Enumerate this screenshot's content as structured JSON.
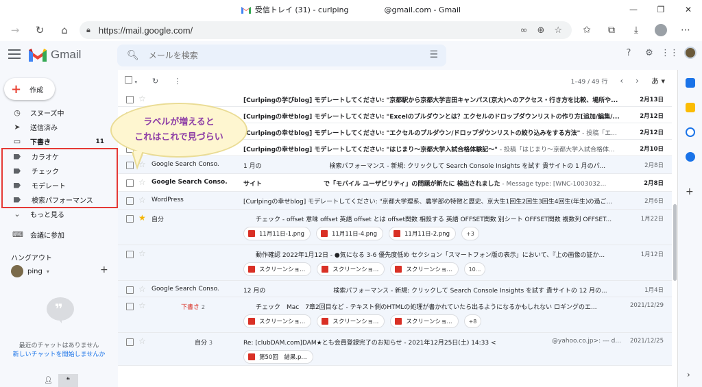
{
  "window": {
    "title_prefix": "受信トレイ (31) - curlping",
    "title_suffix": "@gmail.com - Gmail"
  },
  "browser": {
    "url": "https://mail.google.com/",
    "window_controls": [
      "—",
      "❐",
      "✕"
    ]
  },
  "gmail": {
    "logo_text": "Gmail",
    "search_placeholder": "メールを検索"
  },
  "nav": {
    "compose": "作成",
    "items": [
      {
        "icon": "snooze-icon",
        "label": "スヌーズ中",
        "count": ""
      },
      {
        "icon": "send-icon",
        "label": "送信済み",
        "count": ""
      },
      {
        "icon": "draft-icon",
        "label": "下書き",
        "count": "11"
      }
    ],
    "labels": [
      "カラオケ",
      "チェック",
      "モデレート",
      "検索パフォーマンス"
    ],
    "more": "もっと見る",
    "meet": "会議に参加"
  },
  "hangouts": {
    "title": "ハングアウト",
    "user": "ping",
    "no_chats": "最近のチャットはありません",
    "start_chat": "新しいチャットを開始しませんか"
  },
  "toolbar": {
    "range": "1–49 / 49 行",
    "lang": "あ"
  },
  "callout": {
    "line1": "ラベルが増えると",
    "line2": "これはこれで見づらい"
  },
  "emails": [
    {
      "sender": "",
      "subject": "[Curlpingの学びblog] モデレートしてください: \"京都駅から京都大学吉田キャンパス(京大)へのアクセス・行き方を比較、場所や...",
      "snippet": "",
      "date": "2月13日",
      "unread": true,
      "starred": false
    },
    {
      "sender": "",
      "subject": "[Curlpingの幸せblog] モデレートしてください: \"Excelのプルダウンとは？エクセルのドロップダウンリストの作り方[追加/編集/...",
      "snippet": "",
      "date": "2月12日",
      "unread": true,
      "starred": false
    },
    {
      "sender": "",
      "subject": "[Curlpingの幸せblog] モデレートしてください: \"エクセルのプルダウン/ドロップダウンリストの絞り込みをする方法\"",
      "snippet": " - 投稿「エ...",
      "date": "2月12日",
      "unread": true,
      "starred": false
    },
    {
      "sender": "",
      "subject": "[Curlpingの幸せblog] モデレートしてください: \"はじまり〜京都大学入試合格体験記〜\"",
      "snippet": " - 投稿「はじまり〜京都大学入試合格体...",
      "date": "2月10日",
      "unread": true,
      "starred": false
    },
    {
      "sender": "Google Search Conso.",
      "subject": "1 月の　　　　　　　　　　　検索パフォーマンス - 新規: クリックして Search Console Insights を試す 貴サイトの 1 月のパ...",
      "snippet": "",
      "date": "2月8日",
      "unread": false,
      "starred": false
    },
    {
      "sender": "Google Search Conso.",
      "subject": "サイト　　　　　　　　　　で「モバイル ユーザビリティ」の問題が新たに 検出されました",
      "snippet": " - Message type: [WNC-1003032...",
      "date": "2月8日",
      "unread": true,
      "starred": false
    },
    {
      "sender": "WordPress",
      "subject": "[Curlpingの幸せblog] モデレートしてください: \"京都大学理系、農学部の特徴と歴史、京大生1回生2回生3回生4回生(年生)の過ご...",
      "snippet": "",
      "date": "2月6日",
      "unread": false,
      "starred": false
    },
    {
      "sender": "自分",
      "subject": "チェック - offset 意味 offset 英語 offset とは offset関数 相殺する 英語 OFFSET関数 別シート OFFSET関数 複数列 OFFSET...",
      "snippet": "",
      "date": "1月22日",
      "unread": false,
      "starred": true,
      "attachments": [
        "11月11日-1.png",
        "11月11日-4.png",
        "11月11日-2.png"
      ],
      "more": "+3"
    },
    {
      "sender": "",
      "subject": "動作確認 2022年1月12日 - ●気になる 3-6 優先度低め セクション「スマートフォン版の表示」において、『上の画像の証か...",
      "snippet": "",
      "date": "1月12日",
      "unread": false,
      "starred": false,
      "attachments": [
        "スクリーンショ...",
        "スクリーンショ...",
        "スクリーンショ..."
      ],
      "more": "10..."
    },
    {
      "sender": "Google Search Conso.",
      "subject": "12 月の　　　　　　　　　　　検索パフォーマンス - 新規: クリックして Search Console Insights を試す 貴サイトの 12 月の...",
      "snippet": "",
      "date": "1月4日",
      "unread": false,
      "starred": false
    },
    {
      "sender": "下書き",
      "sender_count": "2",
      "subject": "チェック　Mac　7章2回目など - テキスト側のHTMLの処理が書かれていたら出るようになるかもしれない ロギングのエ...",
      "snippet": "",
      "date": "2021/12/29",
      "unread": false,
      "starred": false,
      "draft": true,
      "attachments": [
        "スクリーンショ...",
        "スクリーンショ...",
        "スクリーンショ..."
      ],
      "more": "+8"
    },
    {
      "sender": "自分",
      "sender_count": "3",
      "subject": "Re: [clubDAM.com]DAM★とも会員登録完了のお知らせ - 2021年12月25日(土) 14:33 <",
      "snippet": "@yahoo.co.jp>: --- d...",
      "date": "2021/12/25",
      "unread": false,
      "starred": false,
      "attachments": [
        "第50回　結果.p..."
      ],
      "more": ""
    }
  ]
}
